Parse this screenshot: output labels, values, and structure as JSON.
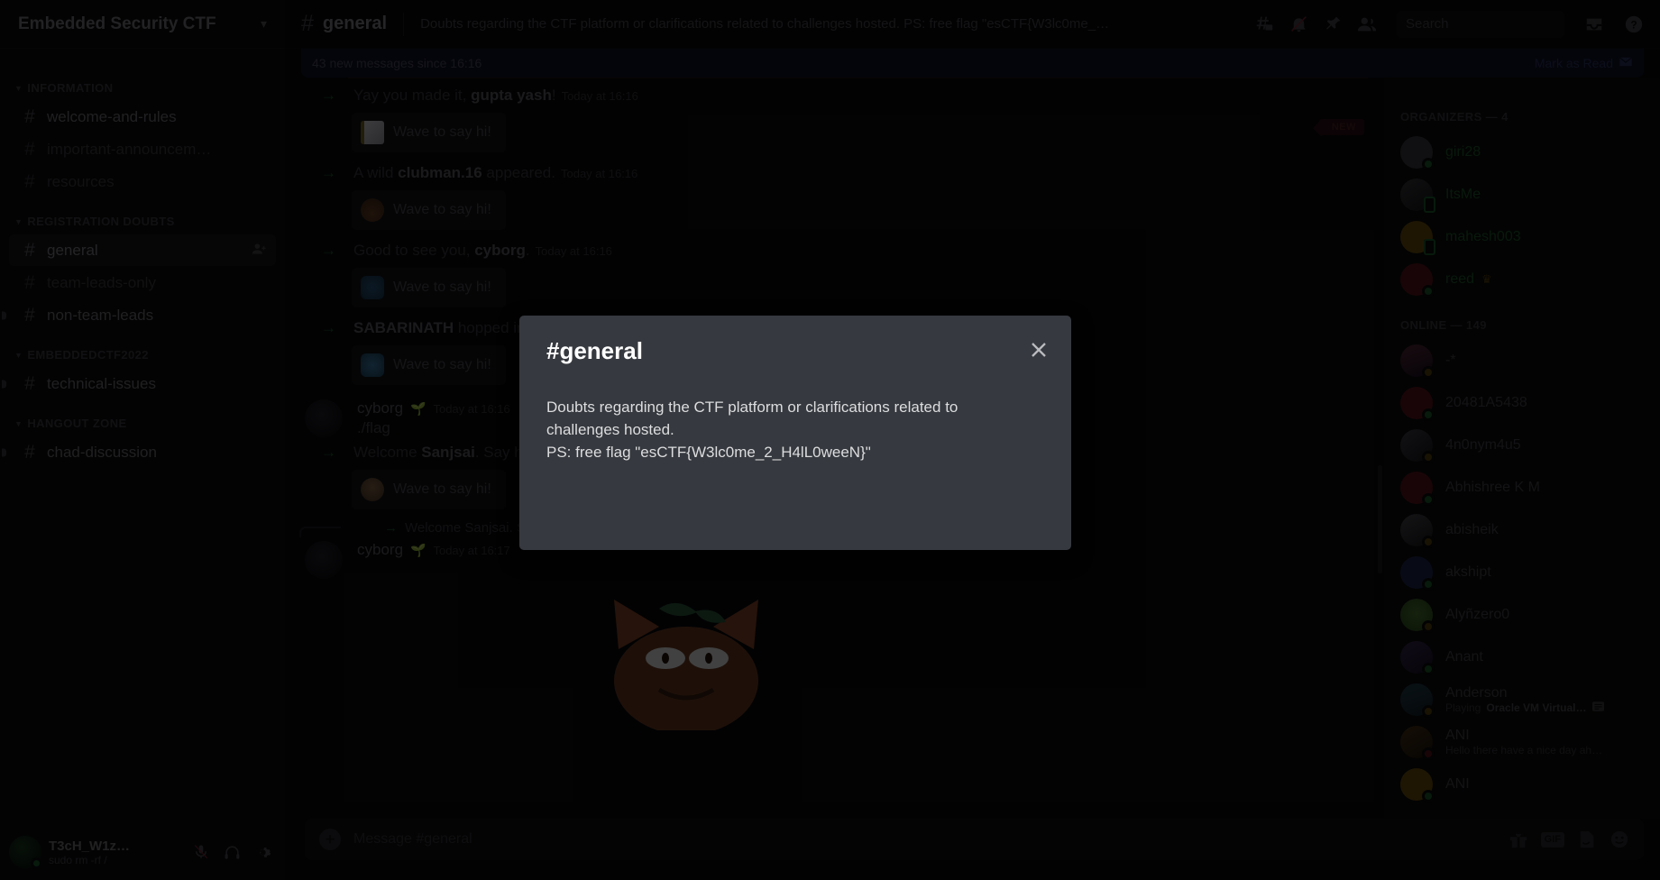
{
  "sidebar": {
    "server_name": "Embedded Security CTF",
    "chevron_icon": "chevron-down-icon",
    "categories": [
      {
        "label": "INFORMATION",
        "channels": [
          {
            "name": "welcome-and-rules",
            "state": "unread",
            "icon": "hash-announcement-icon"
          },
          {
            "name": "important-announcem…",
            "state": "muted",
            "icon": "hash-icon"
          },
          {
            "name": "resources",
            "state": "muted",
            "icon": "hash-icon"
          }
        ]
      },
      {
        "label": "REGISTRATION DOUBTS",
        "channels": [
          {
            "name": "general",
            "state": "active",
            "icon": "hash-icon",
            "trailing_icon": "add-member-icon"
          },
          {
            "name": "team-leads-only",
            "state": "muted",
            "icon": "hash-icon"
          },
          {
            "name": "non-team-leads",
            "state": "unread",
            "icon": "hash-icon"
          }
        ]
      },
      {
        "label": "EMBEDDEDCTF2022",
        "channels": [
          {
            "name": "technical-issues",
            "state": "unread",
            "icon": "hash-icon"
          }
        ]
      },
      {
        "label": "HANGOUT ZONE",
        "channels": [
          {
            "name": "chad-discussion",
            "state": "unread",
            "icon": "hash-icon"
          }
        ]
      }
    ],
    "user_panel": {
      "username": "T3cH_W1z…",
      "status_text": "sudo rm -rf /",
      "icons": [
        "mic-muted-icon",
        "headphones-icon",
        "gear-icon"
      ]
    }
  },
  "topbar": {
    "hash_icon": "hash-icon",
    "channel_title": "general",
    "topic": "Doubts regarding the CTF platform or clarifications related to challenges hosted. PS: free flag \"esCTF{W3lc0me_…",
    "icons": [
      "threads-icon",
      "bell-muted-icon",
      "pin-icon",
      "members-icon"
    ],
    "search": {
      "placeholder": "Search",
      "value": "",
      "icon": "search-icon"
    },
    "right_icons": [
      "inbox-icon",
      "help-icon"
    ]
  },
  "banner": {
    "text": "43 new messages since 16:16",
    "mark_as_read": "Mark as Read",
    "mark_icon": "mark-read-icon"
  },
  "new_badge": "NEW",
  "messages": [
    {
      "kind": "system-join",
      "arrow_icon": "arrow-right-icon",
      "prefix": "Yay you made it, ",
      "user": "gupta yash",
      "suffix": "!",
      "time": "Today at 16:16",
      "wave_label": "Wave to say hi!",
      "wave_emoji": "wave-emoji-ghost"
    },
    {
      "kind": "system-join",
      "arrow_icon": "arrow-right-icon",
      "prefix": "A wild ",
      "user": "clubman.16",
      "suffix": " appeared.",
      "time": "Today at 16:16",
      "wave_label": "Wave to say hi!",
      "wave_emoji": "wave-emoji-sup"
    },
    {
      "kind": "system-join",
      "arrow_icon": "arrow-right-icon",
      "prefix": "Good to see you, ",
      "user": "cyborg",
      "suffix": ".",
      "time": "Today at 16:16",
      "wave_label": "Wave to say hi!",
      "wave_emoji": "wave-emoji-robot"
    },
    {
      "kind": "system-join",
      "arrow_icon": "arrow-right-icon",
      "prefix": "",
      "user": "SABARINATH",
      "suffix": " hopped into the server.",
      "time": "",
      "wave_label": "Wave to say hi!",
      "wave_emoji": "wave-emoji-blue"
    },
    {
      "kind": "user",
      "author": "cyborg",
      "author_badge": "seedling-emoji",
      "time": "Today at 16:16",
      "content": "./flag"
    },
    {
      "kind": "system-join",
      "arrow_icon": "arrow-right-icon",
      "prefix": "Welcome ",
      "user": "Sanjsai",
      "suffix": ". Say hi!",
      "time": "",
      "wave_label": "Wave to say hi!",
      "wave_emoji": "wave-emoji-person"
    },
    {
      "kind": "reply",
      "reply_arrow_icon": "reply-arrow-icon",
      "reply_text": "Welcome Sanjsai. Say hi!",
      "author": "cyborg",
      "author_badge": "seedling-emoji",
      "time": "Today at 16:17",
      "attachment": "cat-sticker-image"
    }
  ],
  "composer": {
    "plus_icon": "add-attachment-icon",
    "placeholder": "Message #general",
    "icons": [
      "gift-icon",
      "gif-icon",
      "sticker-icon",
      "emoji-icon"
    ],
    "gif_label": "GIF"
  },
  "members": {
    "groups": [
      {
        "header": "ORGANIZERS — 4",
        "people": [
          {
            "name": "giri28",
            "role_colored": true,
            "status": "online",
            "avatar_color": "#3b3b40"
          },
          {
            "name": "ItsMe",
            "role_colored": true,
            "status": "mobile",
            "avatar_color": "#2a2a2e"
          },
          {
            "name": "mahesh003",
            "role_colored": true,
            "status": "mobile",
            "avatar_color": "#6b4f0d"
          },
          {
            "name": "reed",
            "role_colored": true,
            "status": "online",
            "avatar_color": "#5c1519",
            "crown": "crown-icon"
          }
        ]
      },
      {
        "header": "ONLINE — 149",
        "people": [
          {
            "name": "-*",
            "role_colored": false,
            "status": "idle",
            "avatar_color": "#3b2230"
          },
          {
            "name": "20481A5438",
            "role_colored": false,
            "status": "online",
            "avatar_color": "#5c1519"
          },
          {
            "name": "4n0nym4u5",
            "role_colored": false,
            "status": "idle",
            "avatar_color": "#2c2c33"
          },
          {
            "name": "Abhishree K M",
            "role_colored": false,
            "status": "online",
            "avatar_color": "#5c1519"
          },
          {
            "name": "abisheik",
            "role_colored": false,
            "status": "idle",
            "avatar_color": "#3a3a3f"
          },
          {
            "name": "akshipt",
            "role_colored": false,
            "status": "online",
            "avatar_color": "#1f2a50"
          },
          {
            "name": "Alyñzero0",
            "role_colored": false,
            "status": "idle",
            "avatar_color": "#3e5c2a"
          },
          {
            "name": "Anant",
            "role_colored": false,
            "status": "online",
            "avatar_color": "#2e2140"
          },
          {
            "name": "Anderson",
            "role_colored": false,
            "status": "idle",
            "avatar_color": "#1d3340",
            "activity_prefix": "Playing ",
            "activity_name": "Oracle VM Virtual…",
            "activity_icon": "activity-icon"
          },
          {
            "name": "ANI",
            "role_colored": false,
            "status": "dnd",
            "avatar_color": "#3a2a18",
            "activity_prefix": "Hello there have a nice day ah…"
          },
          {
            "name": "ANI",
            "role_colored": false,
            "status": "online",
            "avatar_color": "#6b4f0d"
          }
        ]
      }
    ]
  },
  "modal": {
    "title": "#general",
    "close_icon": "close-icon",
    "body": "Doubts regarding the CTF platform or clarifications related to\nchallenges hosted.\nPS: free flag \"esCTF{W3lc0me_2_H4lL0weeN}\""
  },
  "colors": {
    "modal_bg": "#36393f",
    "banner_bg": "#10132a",
    "new_badge_bg": "#2a0e12",
    "online": "#1a5e2c",
    "idle": "#5a4410",
    "dnd": "#5c1519"
  }
}
